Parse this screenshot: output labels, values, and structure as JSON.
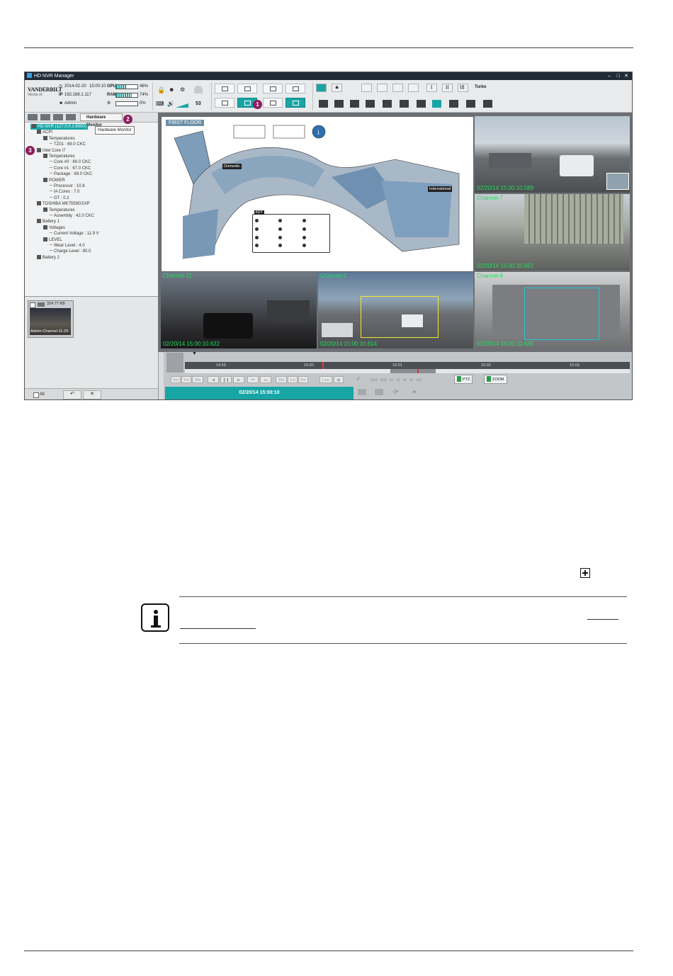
{
  "app": {
    "title": "HD NVR Manager",
    "brand": "VANDERBILT",
    "brand_sub": "Vectis iX",
    "date": "2014-02-20",
    "time": "15:00:10",
    "ip_label": "IP",
    "ip": "192.168.1.117",
    "user": "Admin",
    "gpu_label": "GPU",
    "gpu_pct": "46%",
    "gpu_fill": 0.46,
    "ram_label": "RAM",
    "ram_pct": "74%",
    "ram_fill": 0.74,
    "disk_pct": "0%",
    "volume": "53",
    "turbo": "Turbo",
    "accent": "#17a5a5",
    "marker_color": "#8e1d5d"
  },
  "markers": {
    "m1": "1",
    "m2": "2",
    "m3": "3"
  },
  "left_panel": {
    "tab_hw": "Hardware Monitor",
    "tooltip": "Hardware Monitor",
    "tree": [
      {
        "label": "HD NVR (127.0.0.1:6000)",
        "level": 0,
        "selected": true
      },
      {
        "label": "ACPI",
        "level": 1
      },
      {
        "label": "Temperatures",
        "level": 2
      },
      {
        "label": "TZ01 : 69.0 CKC",
        "level": 3
      },
      {
        "label": "Intel Core i7",
        "level": 1
      },
      {
        "label": "Temperatures",
        "level": 2
      },
      {
        "label": "Core #0 : 69.0 CKC",
        "level": 3
      },
      {
        "label": "Core #1 : 67.0 CKC",
        "level": 3
      },
      {
        "label": "Package : 69.0 CKC",
        "level": 3
      },
      {
        "label": "POWER",
        "level": 2
      },
      {
        "label": "Processor : 10.8",
        "level": 3
      },
      {
        "label": "IA Cores : 7.0",
        "level": 3
      },
      {
        "label": "GT : 0.2",
        "level": 3
      },
      {
        "label": "TOSHIBA MK7559GSXP",
        "level": 1
      },
      {
        "label": "Temperatures",
        "level": 2
      },
      {
        "label": "Assembly : 42.0 CKC",
        "level": 3
      },
      {
        "label": "Battery 1",
        "level": 1
      },
      {
        "label": "Voltages",
        "level": 2
      },
      {
        "label": "Current Voltage : 11.9 V",
        "level": 3
      },
      {
        "label": "LEVEL",
        "level": 2
      },
      {
        "label": "Wear Level : 4.0",
        "level": 3
      },
      {
        "label": "Charge Level : 80.0",
        "level": 3
      },
      {
        "label": "Battery 2",
        "level": 1
      }
    ],
    "thumb_size": "324.77 KB",
    "thumb_label": "Admin-Channel-11-20",
    "all_label": "All"
  },
  "map": {
    "title": "FIRST FLOOR",
    "domestic": "Domestic",
    "international": "International",
    "key": "KEY"
  },
  "channels": [
    {
      "name": "",
      "timestamp": "02/20/14  15:00:10.589"
    },
    {
      "name": "Channel-7",
      "timestamp": "02/20/14  15:00:10.662"
    },
    {
      "name": "Channel-11",
      "timestamp": "02/20/14  15:00:10.622"
    },
    {
      "name": "Channel-5",
      "timestamp": "02/20/14  15:00:10.614"
    },
    {
      "name": "Channel-8",
      "timestamp": "02/20/14  15:00:10.630"
    }
  ],
  "timeline": {
    "ticks": [
      "14:59",
      "15:00",
      "15:01",
      "15:02",
      "15:03"
    ],
    "controls": [
      "5m",
      "1m",
      "30s",
      "◀",
      "❚❚",
      "▶",
      "⏮",
      "⏭",
      "30s",
      "1m",
      "5m",
      "Live"
    ],
    "speeds": [
      "x1/4",
      "x1/2",
      "x1",
      "x2",
      "x4",
      "x8",
      "x16"
    ],
    "current": "02/20/14 15:00:10",
    "ptz": "PTZ",
    "zoom": "ZOOM"
  }
}
